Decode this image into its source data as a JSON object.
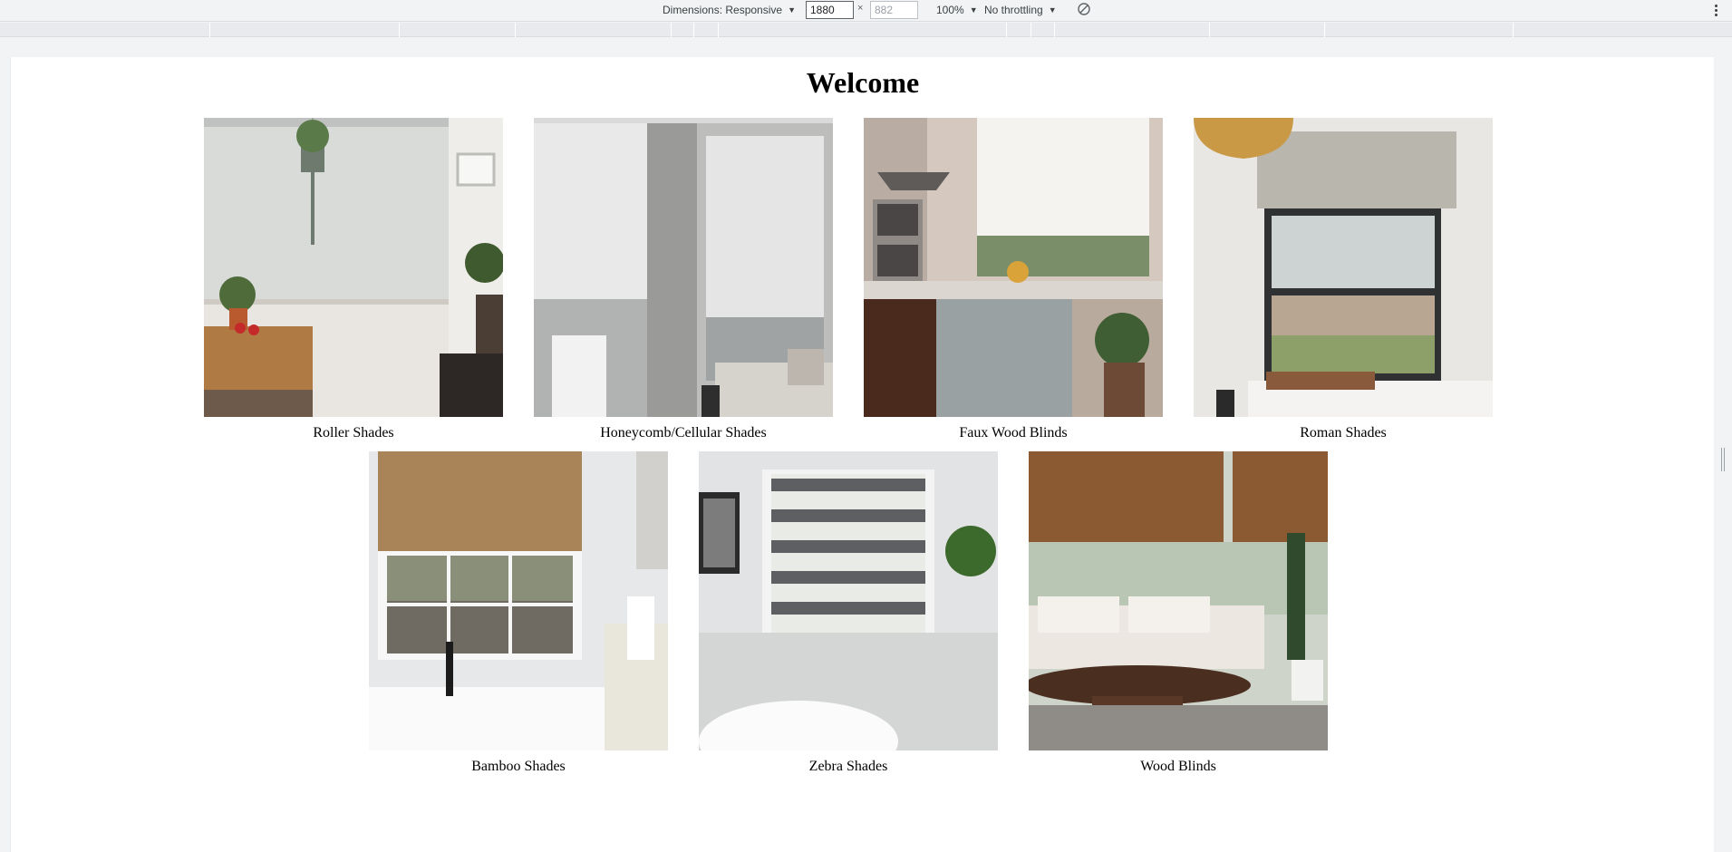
{
  "toolbar": {
    "dimensions_label": "Dimensions: Responsive",
    "width_value": "1880",
    "height_placeholder": "882",
    "times_sign": "×",
    "zoom_label": "100%",
    "throttle_label": "No throttling",
    "icons": [
      "caret-down-icon",
      "rotate-icon",
      "more-options-icon"
    ]
  },
  "page": {
    "title": "Welcome"
  },
  "products": [
    {
      "label": "Roller Shades"
    },
    {
      "label": "Honeycomb/Cellular Shades"
    },
    {
      "label": "Faux Wood Blinds"
    },
    {
      "label": "Roman Shades"
    },
    {
      "label": "Bamboo Shades"
    },
    {
      "label": "Zebra Shades"
    },
    {
      "label": "Wood Blinds"
    }
  ],
  "colors": {
    "toolbar_bg": "#f1f3f4",
    "ruler_bg": "#e8eaed",
    "page_bg": "#ffffff"
  }
}
